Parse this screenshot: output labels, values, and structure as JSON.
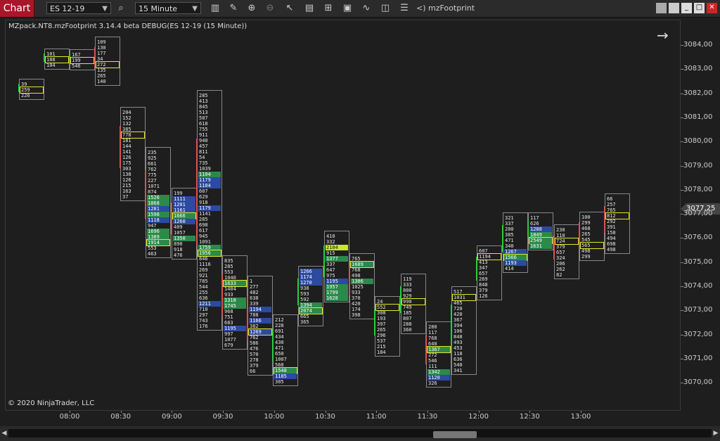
{
  "toolbar": {
    "chart_tab": "Chart",
    "instrument": "ES 12-19",
    "interval": "15 Minute",
    "indicator_label": "<) mzFootprint",
    "icons": [
      "search-icon",
      "bar-style-icon",
      "draw-icon",
      "zoom-in-icon",
      "zoom-out-icon",
      "pointer-icon",
      "properties-icon",
      "template-icon",
      "data-box-icon",
      "strategies-icon",
      "alerts-icon",
      "list-icon"
    ]
  },
  "chart": {
    "title": "MZpack.NT8.mzFootprint 3.14.4 beta DEBUG(ES 12-19 (15 Minute))",
    "copyright": "© 2020 NinjaTrader, LLC",
    "current_price": "3077,25",
    "price_ticks": [
      "3084,00",
      "3083,00",
      "3082,00",
      "3081,00",
      "3080,00",
      "3079,00",
      "3078,00",
      "3077,00",
      "3076,00",
      "3075,00",
      "3074,00",
      "3073,00",
      "3072,00",
      "3071,00",
      "3070,00"
    ],
    "time_ticks": [
      "08:00",
      "08:30",
      "09:00",
      "09:30",
      "10:00",
      "10:30",
      "11:00",
      "11:30",
      "12:00",
      "12:30",
      "13:00"
    ],
    "colors": {
      "bid": "#2b4aa0",
      "ask": "#2b8a4a",
      "poc": "#e5e52a",
      "up": "#2ecc40",
      "down": "#d9534f"
    }
  },
  "bars": [
    {
      "rows": [
        {
          "t": "39"
        },
        {
          "t": "259",
          "c": "poc"
        },
        {
          "t": "226"
        }
      ]
    },
    {
      "rows": [
        {
          "t": "101"
        },
        {
          "t": "188",
          "c": "poc"
        },
        {
          "t": "104"
        }
      ]
    },
    {
      "rows": [
        {
          "t": "167"
        },
        {
          "t": "199",
          "c": "poc"
        },
        {
          "t": "546"
        }
      ]
    },
    {
      "rows": [
        {
          "t": "109"
        },
        {
          "t": "130"
        },
        {
          "t": "177"
        },
        {
          "t": "34"
        },
        {
          "t": "272",
          "c": "poc"
        },
        {
          "t": "135"
        },
        {
          "t": "265"
        },
        {
          "t": "140"
        }
      ]
    },
    {
      "rows": [
        {
          "t": "204"
        },
        {
          "t": "152"
        },
        {
          "t": "132"
        },
        {
          "t": "385"
        },
        {
          "t": "778",
          "c": "poc"
        },
        {
          "t": "181"
        },
        {
          "t": "144"
        },
        {
          "t": "141"
        },
        {
          "t": "126"
        },
        {
          "t": "175"
        },
        {
          "t": "303"
        },
        {
          "t": "138"
        },
        {
          "t": "126"
        },
        {
          "t": "215"
        },
        {
          "t": "163"
        },
        {
          "t": "37"
        }
      ]
    },
    {
      "rows": [
        {
          "t": "235"
        },
        {
          "t": "925"
        },
        {
          "t": "661"
        },
        {
          "t": "762"
        },
        {
          "t": "775"
        },
        {
          "t": "227"
        },
        {
          "t": "1071"
        },
        {
          "t": "874"
        },
        {
          "t": "1526",
          "c": "ask"
        },
        {
          "t": "1868",
          "c": "ask"
        },
        {
          "t": "1281",
          "c": "bid"
        },
        {
          "t": "1598",
          "c": "ask"
        },
        {
          "t": "1118",
          "c": "bid"
        },
        {
          "t": "947"
        },
        {
          "t": "1696",
          "c": "ask"
        },
        {
          "t": "1389",
          "c": "ask"
        },
        {
          "t": "1914",
          "c": "poc ask"
        },
        {
          "t": "553"
        },
        {
          "t": "463"
        }
      ]
    },
    {
      "rows": [
        {
          "t": "199"
        },
        {
          "t": "1111",
          "c": "bid"
        },
        {
          "t": "1201",
          "c": "bid"
        },
        {
          "t": "1161",
          "c": "bid"
        },
        {
          "t": "1666",
          "c": "poc ask"
        },
        {
          "t": "1260",
          "c": "bid"
        },
        {
          "t": "409"
        },
        {
          "t": "1057"
        },
        {
          "t": "1350",
          "c": "ask"
        },
        {
          "t": "890"
        },
        {
          "t": "918"
        },
        {
          "t": "476"
        }
      ]
    },
    {
      "rows": [
        {
          "t": "285"
        },
        {
          "t": "413"
        },
        {
          "t": "845"
        },
        {
          "t": "513"
        },
        {
          "t": "507"
        },
        {
          "t": "618"
        },
        {
          "t": "755"
        },
        {
          "t": "911"
        },
        {
          "t": "940"
        },
        {
          "t": "457"
        },
        {
          "t": "811"
        },
        {
          "t": "54"
        },
        {
          "t": "735"
        },
        {
          "t": "1039"
        },
        {
          "t": "1104",
          "c": "ask"
        },
        {
          "t": "1179",
          "c": "bid"
        },
        {
          "t": "1104",
          "c": "bid"
        },
        {
          "t": "607"
        },
        {
          "t": "629"
        },
        {
          "t": "918"
        },
        {
          "t": "1179",
          "c": "bid"
        },
        {
          "t": "1141"
        },
        {
          "t": "285"
        },
        {
          "t": "698"
        },
        {
          "t": "617"
        },
        {
          "t": "945"
        },
        {
          "t": "1091"
        },
        {
          "t": "1759",
          "c": "ask"
        },
        {
          "t": "1956",
          "c": "poc ask"
        },
        {
          "t": "846"
        },
        {
          "t": "1116"
        },
        {
          "t": "269"
        },
        {
          "t": "921"
        },
        {
          "t": "785"
        },
        {
          "t": "544"
        },
        {
          "t": "255"
        },
        {
          "t": "636"
        },
        {
          "t": "1211",
          "c": "bid"
        },
        {
          "t": "710"
        },
        {
          "t": "297"
        },
        {
          "t": "743"
        },
        {
          "t": "176"
        }
      ]
    },
    {
      "rows": [
        {
          "t": "835"
        },
        {
          "t": "285"
        },
        {
          "t": "553"
        },
        {
          "t": "1040"
        },
        {
          "t": "1633",
          "c": "poc ask"
        },
        {
          "t": "1404"
        },
        {
          "t": "933"
        },
        {
          "t": "1318",
          "c": "ask"
        },
        {
          "t": "1745",
          "c": "ask"
        },
        {
          "t": "968"
        },
        {
          "t": "751"
        },
        {
          "t": "683"
        },
        {
          "t": "1195",
          "c": "bid"
        },
        {
          "t": "997"
        },
        {
          "t": "1077"
        },
        {
          "t": "679"
        }
      ]
    },
    {
      "rows": [
        {
          "t": "1"
        },
        {
          "t": "277"
        },
        {
          "t": "482"
        },
        {
          "t": "638"
        },
        {
          "t": "339"
        },
        {
          "t": "1194",
          "c": "bid"
        },
        {
          "t": "788"
        },
        {
          "t": "1166",
          "c": "bid"
        },
        {
          "t": "382"
        },
        {
          "t": "1269",
          "c": "poc bid"
        },
        {
          "t": "762"
        },
        {
          "t": "586"
        },
        {
          "t": "476"
        },
        {
          "t": "570"
        },
        {
          "t": "278"
        },
        {
          "t": "379"
        },
        {
          "t": "66"
        }
      ]
    },
    {
      "rows": [
        {
          "t": "212"
        },
        {
          "t": "228"
        },
        {
          "t": "691"
        },
        {
          "t": "434"
        },
        {
          "t": "430"
        },
        {
          "t": "471"
        },
        {
          "t": "650"
        },
        {
          "t": "1007"
        },
        {
          "t": "560"
        },
        {
          "t": "1548",
          "c": "poc ask"
        },
        {
          "t": "1185",
          "c": "bid"
        },
        {
          "t": "305"
        }
      ]
    },
    {
      "rows": [
        {
          "t": "1266",
          "c": "bid"
        },
        {
          "t": "1174",
          "c": "bid"
        },
        {
          "t": "1270",
          "c": "bid"
        },
        {
          "t": "938"
        },
        {
          "t": "593"
        },
        {
          "t": "592"
        },
        {
          "t": "1394",
          "c": "ask"
        },
        {
          "t": "2074",
          "c": "poc ask"
        },
        {
          "t": "665"
        },
        {
          "t": "365"
        }
      ]
    },
    {
      "rows": [
        {
          "t": "410"
        },
        {
          "t": "332"
        },
        {
          "t": "2104",
          "c": "hi"
        },
        {
          "t": "915"
        },
        {
          "t": "1377",
          "c": "ask"
        },
        {
          "t": "337"
        },
        {
          "t": "647"
        },
        {
          "t": "975"
        },
        {
          "t": "1195",
          "c": "bid"
        },
        {
          "t": "1957",
          "c": "ask"
        },
        {
          "t": "1799",
          "c": "ask"
        },
        {
          "t": "1628",
          "c": "ask"
        }
      ]
    },
    {
      "rows": [
        {
          "t": "765"
        },
        {
          "t": "1689",
          "c": "poc ask"
        },
        {
          "t": "768"
        },
        {
          "t": "498"
        },
        {
          "t": "1306",
          "c": "ask"
        },
        {
          "t": "1025"
        },
        {
          "t": "933"
        },
        {
          "t": "370"
        },
        {
          "t": "420"
        },
        {
          "t": "174"
        },
        {
          "t": "398"
        }
      ]
    },
    {
      "rows": [
        {
          "t": "24"
        },
        {
          "t": "552",
          "c": "poc"
        },
        {
          "t": "308"
        },
        {
          "t": "193"
        },
        {
          "t": "397"
        },
        {
          "t": "265"
        },
        {
          "t": "296"
        },
        {
          "t": "537"
        },
        {
          "t": "215"
        },
        {
          "t": "184"
        }
      ]
    },
    {
      "rows": [
        {
          "t": "119"
        },
        {
          "t": "333"
        },
        {
          "t": "800"
        },
        {
          "t": "929"
        },
        {
          "t": "990",
          "c": "poc"
        },
        {
          "t": "749"
        },
        {
          "t": "185"
        },
        {
          "t": "807"
        },
        {
          "t": "288"
        },
        {
          "t": "360"
        }
      ]
    },
    {
      "rows": [
        {
          "t": "280"
        },
        {
          "t": "117"
        },
        {
          "t": "768"
        },
        {
          "t": "640"
        },
        {
          "t": "1367",
          "c": "poc ask"
        },
        {
          "t": "272"
        },
        {
          "t": "546"
        },
        {
          "t": "111"
        },
        {
          "t": "1342",
          "c": "ask"
        },
        {
          "t": "1120",
          "c": "bid"
        },
        {
          "t": "326"
        }
      ]
    },
    {
      "rows": [
        {
          "t": "517"
        },
        {
          "t": "1031",
          "c": "poc"
        },
        {
          "t": "465"
        },
        {
          "t": "720"
        },
        {
          "t": "420"
        },
        {
          "t": "367"
        },
        {
          "t": "394"
        },
        {
          "t": "106"
        },
        {
          "t": "848"
        },
        {
          "t": "493"
        },
        {
          "t": "453"
        },
        {
          "t": "118"
        },
        {
          "t": "636"
        },
        {
          "t": "540"
        },
        {
          "t": "341"
        }
      ]
    },
    {
      "rows": [
        {
          "t": "607"
        },
        {
          "t": "1194",
          "c": "poc"
        },
        {
          "t": "413"
        },
        {
          "t": "347"
        },
        {
          "t": "657"
        },
        {
          "t": "269"
        },
        {
          "t": "848"
        },
        {
          "t": "379"
        },
        {
          "t": "126"
        }
      ]
    },
    {
      "rows": [
        {
          "t": "321"
        },
        {
          "t": "337"
        },
        {
          "t": "200"
        },
        {
          "t": "385"
        },
        {
          "t": "471"
        },
        {
          "t": "340"
        },
        {
          "t": "1267",
          "c": "bid"
        },
        {
          "t": "1566",
          "c": "poc ask"
        },
        {
          "t": "1193",
          "c": "bid"
        },
        {
          "t": "414"
        }
      ]
    },
    {
      "rows": [
        {
          "t": "117"
        },
        {
          "t": "626"
        },
        {
          "t": "1288",
          "c": "bid"
        },
        {
          "t": "1849",
          "c": "ask"
        },
        {
          "t": "2549",
          "c": "poc ask"
        },
        {
          "t": "1631",
          "c": "ask"
        }
      ]
    },
    {
      "rows": [
        {
          "t": "230"
        },
        {
          "t": "110"
        },
        {
          "t": "724",
          "c": "poc"
        },
        {
          "t": "379"
        },
        {
          "t": "657"
        },
        {
          "t": "324"
        },
        {
          "t": "206"
        },
        {
          "t": "262"
        },
        {
          "t": "82"
        }
      ]
    },
    {
      "rows": [
        {
          "t": "100"
        },
        {
          "t": "299"
        },
        {
          "t": "468"
        },
        {
          "t": "265"
        },
        {
          "t": "545"
        },
        {
          "t": "565",
          "c": "poc"
        },
        {
          "t": "498"
        },
        {
          "t": "299"
        }
      ]
    },
    {
      "rows": [
        {
          "t": "66"
        },
        {
          "t": "257"
        },
        {
          "t": "765"
        },
        {
          "t": "812",
          "c": "poc"
        },
        {
          "t": "292"
        },
        {
          "t": "391"
        },
        {
          "t": "158"
        },
        {
          "t": "494"
        },
        {
          "t": "698"
        },
        {
          "t": "498"
        }
      ]
    }
  ]
}
